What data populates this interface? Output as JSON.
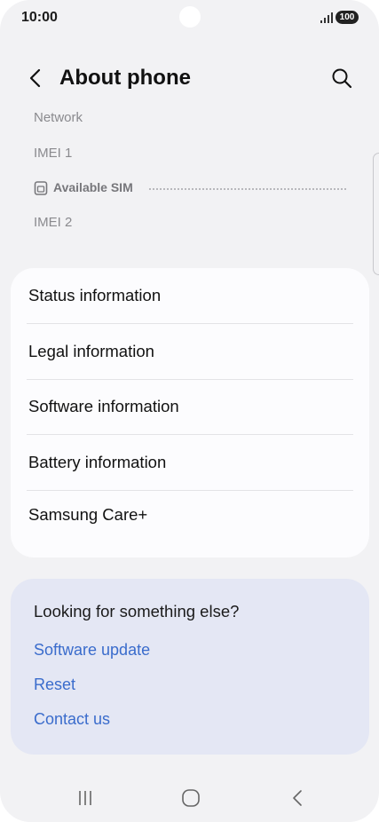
{
  "status_bar": {
    "time": "10:00",
    "battery": "100"
  },
  "header": {
    "title": "About phone"
  },
  "info": {
    "network_label": "Network",
    "imei1_label": "IMEI 1",
    "available_sim_label": "Available SIM",
    "imei2_label": "IMEI 2"
  },
  "menu": {
    "items": [
      {
        "label": "Status information"
      },
      {
        "label": "Legal information"
      },
      {
        "label": "Software information"
      },
      {
        "label": "Battery information"
      },
      {
        "label": "Samsung Care+"
      }
    ]
  },
  "suggestions": {
    "title": "Looking for something else?",
    "links": [
      {
        "label": "Software update"
      },
      {
        "label": "Reset"
      },
      {
        "label": "Contact us"
      }
    ]
  },
  "colors": {
    "link": "#3a6ccc",
    "background": "#f2f2f4",
    "suggest_bg": "#e4e7f4"
  },
  "icons": [
    "back-arrow-icon",
    "search-icon",
    "sim-card-icon",
    "recent-apps-icon",
    "home-icon",
    "back-nav-icon"
  ]
}
